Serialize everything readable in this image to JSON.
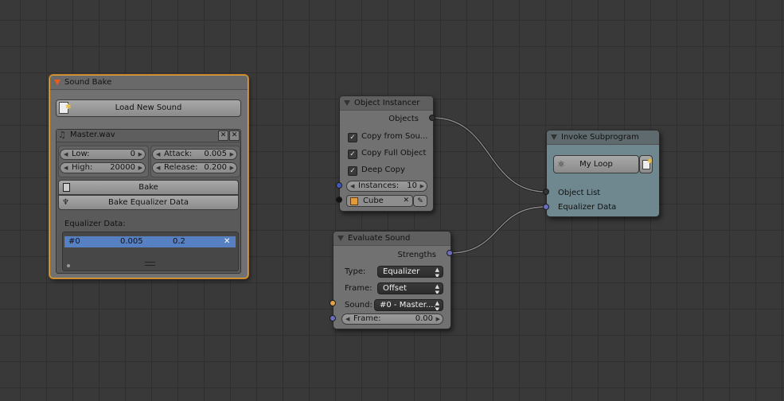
{
  "colors": {
    "grid_bg": "#393939",
    "node_bg": "#717171",
    "active_border": "#e8a23a",
    "subprogram_bg": "#6f878f",
    "selected_row": "#5680c2",
    "socket_list": "#3f5abf",
    "socket_generic": "#6c6cbe",
    "socket_sound": "#e1a24a",
    "socket_object": "#222222"
  },
  "sound_bake": {
    "title": "Sound Bake",
    "load_label": "Load New Sound",
    "file_name": "Master.wav",
    "low_label": "Low:",
    "low_value": "0",
    "high_label": "High:",
    "high_value": "20000",
    "attack_label": "Attack:",
    "attack_value": "0.005",
    "release_label": "Release:",
    "release_value": "0.200",
    "bake_label": "Bake",
    "bake_eq_label": "Bake Equalizer Data",
    "eq_title": "Equalizer Data:",
    "eq_rows": [
      {
        "index": "#0",
        "attack": "0.005",
        "release": "0.2"
      }
    ]
  },
  "object_instancer": {
    "title": "Object Instancer",
    "output": "Objects",
    "options": [
      {
        "label": "Copy from Sou...",
        "checked": true
      },
      {
        "label": "Copy Full Object",
        "checked": true
      },
      {
        "label": "Deep Copy",
        "checked": true
      }
    ],
    "instances_label": "Instances:",
    "instances_value": "10",
    "object_name": "Cube"
  },
  "invoke": {
    "title": "Invoke Subprogram",
    "program": "My Loop",
    "inputs": [
      "Object List",
      "Equalizer Data"
    ]
  },
  "evaluate": {
    "title": "Evaluate Sound",
    "output": "Strengths",
    "type_label": "Type:",
    "type_value": "Equalizer",
    "frame_type_label": "Frame:",
    "frame_type_value": "Offset",
    "sound_label": "Sound:",
    "sound_value": "#0 - Master....",
    "frame_label": "Frame:",
    "frame_value": "0.00"
  }
}
